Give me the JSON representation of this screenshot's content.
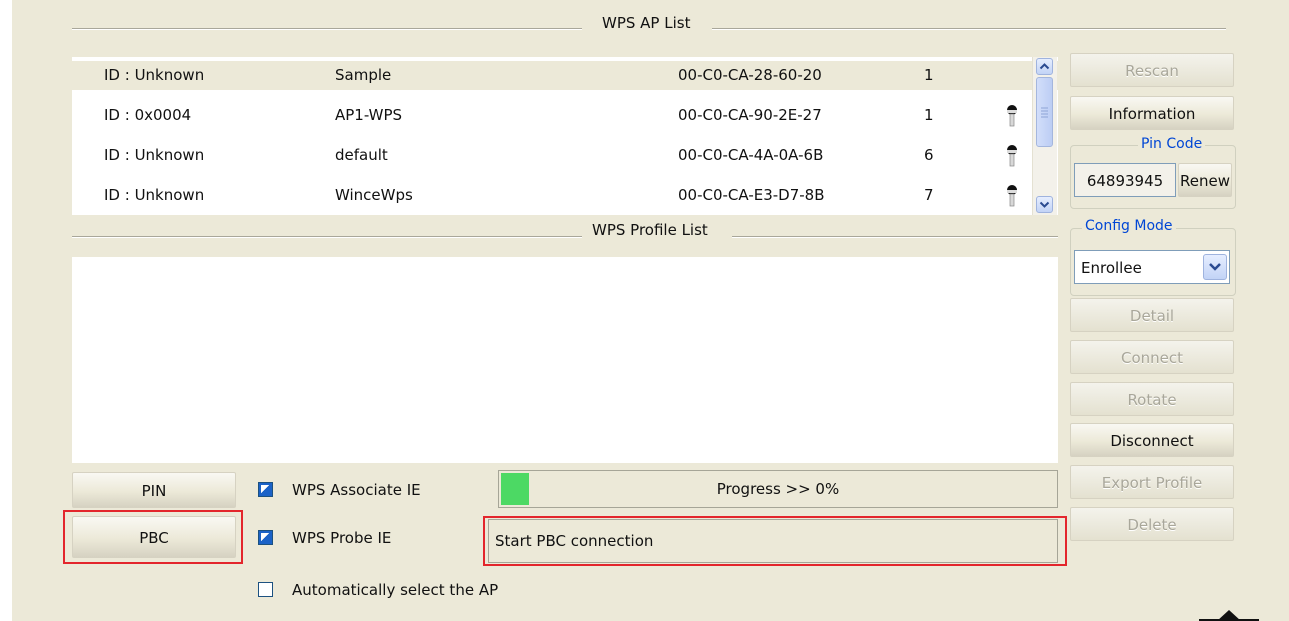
{
  "ap_list": {
    "title": "WPS AP List",
    "rows": [
      {
        "id": "ID : Unknown",
        "ssid": "Sample",
        "bssid": "00-C0-CA-28-60-20",
        "channel": "1",
        "locked": false,
        "selected": true
      },
      {
        "id": "ID : 0x0004",
        "ssid": "AP1-WPS",
        "bssid": "00-C0-CA-90-2E-27",
        "channel": "1",
        "locked": true,
        "selected": false
      },
      {
        "id": "ID : Unknown",
        "ssid": "default",
        "bssid": "00-C0-CA-4A-0A-6B",
        "channel": "6",
        "locked": true,
        "selected": false
      },
      {
        "id": "ID : Unknown",
        "ssid": "WinceWps",
        "bssid": "00-C0-CA-E3-D7-8B",
        "channel": "7",
        "locked": true,
        "selected": false
      }
    ]
  },
  "profile_list": {
    "title": "WPS Profile List"
  },
  "side": {
    "rescan": "Rescan",
    "information": "Information",
    "pin_code_label": "Pin Code",
    "pin_code": "64893945",
    "renew": "Renew",
    "config_mode_label": "Config Mode",
    "config_mode": "Enrollee",
    "detail": "Detail",
    "connect": "Connect",
    "rotate": "Rotate",
    "disconnect": "Disconnect",
    "export_profile": "Export Profile",
    "delete": "Delete"
  },
  "bottom": {
    "pin_button": "PIN",
    "pbc_button": "PBC",
    "assoc_ie": "WPS Associate IE",
    "probe_ie": "WPS Probe IE",
    "auto_select": "Automatically select the AP",
    "progress_text": "Progress >> 0%",
    "progress_value": 0,
    "status": "Start PBC connection"
  },
  "colors": {
    "highlight": "#e3262c",
    "progress": "#4cd964",
    "legend": "#0046d5"
  }
}
